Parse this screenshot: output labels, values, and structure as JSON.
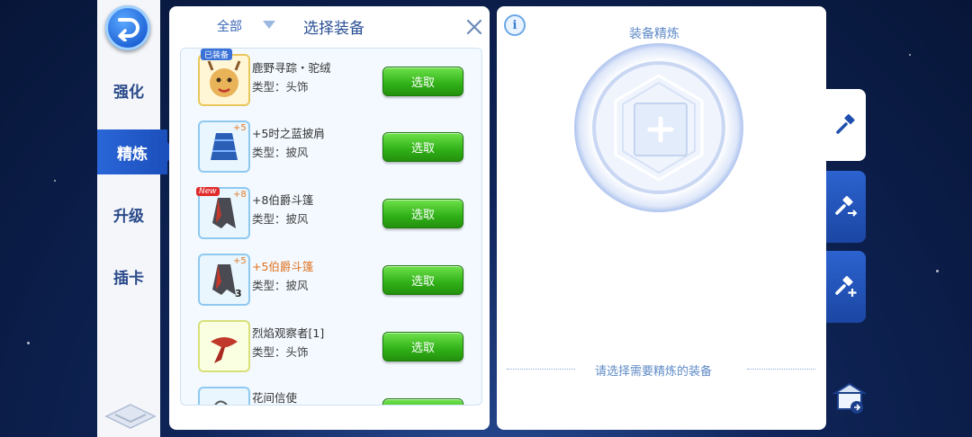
{
  "nav": {
    "items": [
      {
        "label": "强化",
        "active": false
      },
      {
        "label": "精炼",
        "active": true
      },
      {
        "label": "升级",
        "active": false
      },
      {
        "label": "插卡",
        "active": false
      }
    ]
  },
  "equipment_panel": {
    "filter_label": "全部",
    "title": "选择装备",
    "items": [
      {
        "name": "鹿野寻踪・驼绒",
        "type": "类型：头饰",
        "button": "选取",
        "badge": "已装备"
      },
      {
        "name": "+5时之蓝披肩",
        "type": "类型：披风",
        "button": "选取",
        "plus": "+5"
      },
      {
        "name": "+8伯爵斗篷",
        "type": "类型：披风",
        "button": "选取",
        "plus": "+8",
        "badge": "New"
      },
      {
        "name": "+5伯爵斗篷",
        "type": "类型：披风",
        "button": "选取",
        "plus": "+5",
        "count": "3"
      },
      {
        "name": "烈焰观察者[1]",
        "type": "类型：头饰",
        "button": "选取"
      },
      {
        "name": "花间信使",
        "type": "",
        "button": "选取"
      }
    ]
  },
  "refine_panel": {
    "title": "装备精炼",
    "hint": "请选择需要精炼的装备"
  },
  "colors": {
    "accent_blue": "#2a66d8",
    "button_green": "#30b018",
    "highlight_orange": "#e0701c"
  }
}
